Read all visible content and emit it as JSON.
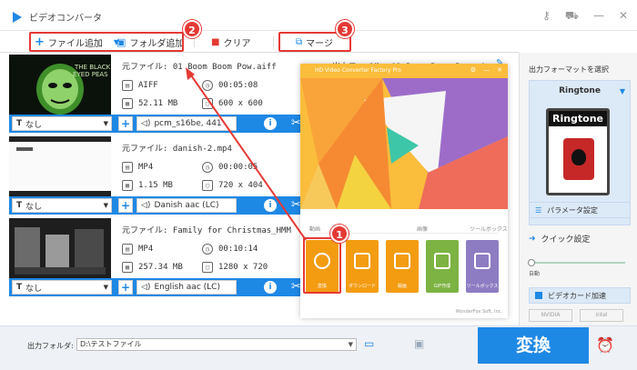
{
  "window": {
    "title": "ビデオコンバータ"
  },
  "toolbar": {
    "add_file": "ファイル追加",
    "add_folder": "フォルダ追加",
    "clear": "クリア",
    "merge": "マージ"
  },
  "badges": {
    "one": "1",
    "two": "2",
    "three": "3"
  },
  "files": [
    {
      "source": "元ファイル: 01 Boom Boom Pow.aiff",
      "format": "AIFF",
      "duration": "00:05:08",
      "size": "52.11 MB",
      "resolution": "600 x 600",
      "subtitle": "なし",
      "audio": "pcm_s16be, 441",
      "output": "出力ファイル: 01 Boom Boom Pow.m4r"
    },
    {
      "source": "元ファイル: danish-2.mp4",
      "format": "MP4",
      "duration": "00:00:05",
      "size": "1.15 MB",
      "resolution": "720 x 404",
      "subtitle": "なし",
      "audio": "Danish aac (LC)"
    },
    {
      "source": "元ファイル: Family for Christmas_HMM",
      "format": "MP4",
      "duration": "00:10:14",
      "size": "257.34 MB",
      "resolution": "1280 x 720",
      "subtitle": "なし",
      "audio": "English aac (LC)"
    }
  ],
  "hub": {
    "title": "HD Video Converter Factory Pro",
    "categories": [
      "動画",
      "画像",
      "ツールボックス"
    ],
    "tools": [
      {
        "label": "変換",
        "color": "#f39c12"
      },
      {
        "label": "ダウンロード",
        "color": "#f39c12"
      },
      {
        "label": "録画",
        "color": "#f39c12"
      },
      {
        "label": "GIF作成",
        "color": "#7cb342"
      },
      {
        "label": "ツールボックス",
        "color": "#8e7cc3"
      }
    ],
    "footer": "WonderFox Soft, Inc."
  },
  "right_panel": {
    "heading": "出力フォーマットを選択",
    "format_name": "Ringtone",
    "format_card_label": "Ringtone",
    "param_settings": "パラメータ設定",
    "quick_settings": "クイック設定",
    "auto_label": "自動",
    "gpu_accel": "ビデオカード加速",
    "nvidia": "NVIDIA",
    "intel": "intel"
  },
  "bottom": {
    "output_folder_label": "出力フォルダ:",
    "output_folder_value": "D:\\テストファイル",
    "convert_button": "変換"
  },
  "colors": {
    "accent": "#1e88e5",
    "highlight": "#e53935"
  }
}
